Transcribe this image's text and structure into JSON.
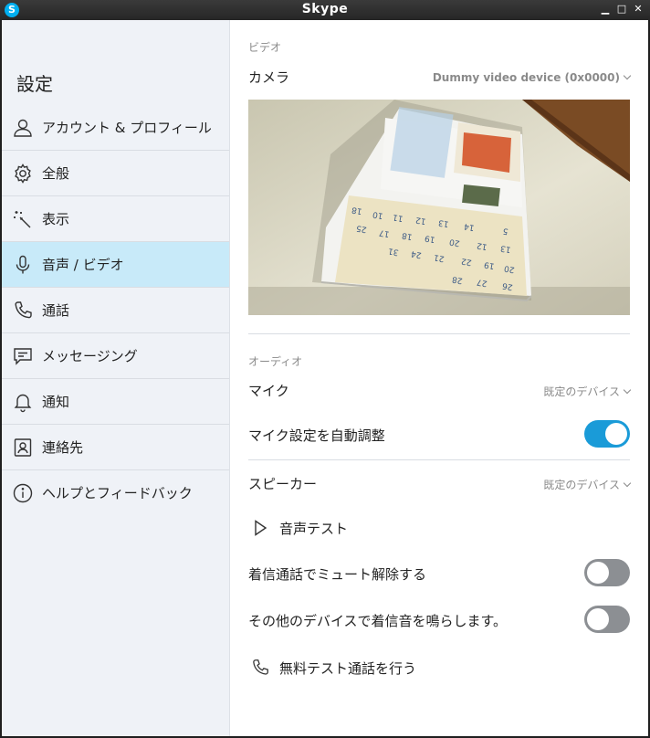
{
  "window": {
    "title": "Skype"
  },
  "sidebar": {
    "heading": "設定",
    "active_index": 3,
    "items": [
      {
        "label": "アカウント & プロフィール",
        "icon": "person-icon"
      },
      {
        "label": "全般",
        "icon": "gear-icon"
      },
      {
        "label": "表示",
        "icon": "magic-wand-icon"
      },
      {
        "label": "音声 / ビデオ",
        "icon": "microphone-icon"
      },
      {
        "label": "通話",
        "icon": "phone-icon"
      },
      {
        "label": "メッセージング",
        "icon": "chat-icon"
      },
      {
        "label": "通知",
        "icon": "bell-icon"
      },
      {
        "label": "連絡先",
        "icon": "contact-card-icon"
      },
      {
        "label": "ヘルプとフィードバック",
        "icon": "info-icon"
      }
    ]
  },
  "video": {
    "section_title": "ビデオ",
    "camera_label": "カメラ",
    "camera_value": "Dummy video device (0x0000)"
  },
  "audio": {
    "section_title": "オーディオ",
    "mic_label": "マイク",
    "mic_value": "既定のデバイス",
    "auto_adjust_label": "マイク設定を自動調整",
    "auto_adjust_on": true,
    "speaker_label": "スピーカー",
    "speaker_value": "既定のデバイス",
    "sound_test_label": "音声テスト",
    "unmute_label": "着信通話でミュート解除する",
    "unmute_on": false,
    "ring_other_label": "その他のデバイスで着信音を鳴らします。",
    "ring_other_on": false,
    "test_call_label": "無料テスト通話を行う"
  },
  "colors": {
    "accent": "#1a9bd8",
    "sidebar_bg": "#eff2f7",
    "active_bg": "#c8eaf9",
    "toggle_off": "#8c8f93"
  }
}
